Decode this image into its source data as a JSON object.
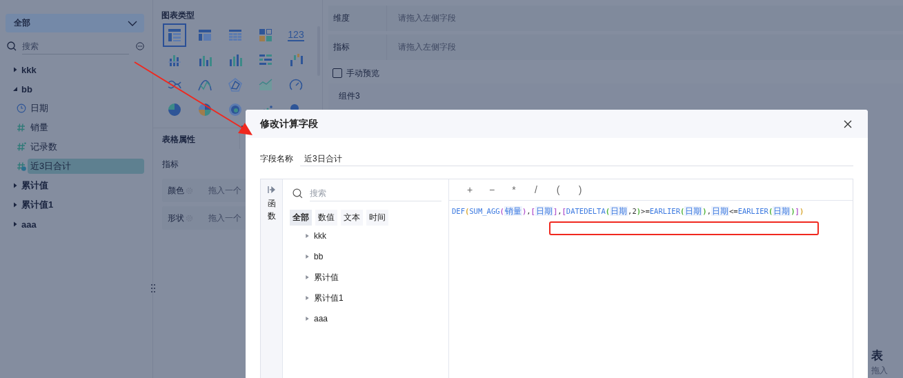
{
  "sidebar": {
    "dropdown": {
      "value": "全部"
    },
    "search": {
      "placeholder": "搜索"
    },
    "tree": [
      {
        "label": "kkk",
        "expanded": false
      },
      {
        "label": "bb",
        "expanded": true,
        "children": [
          {
            "label": "日期",
            "kind": "date",
            "selected": false
          },
          {
            "label": "销量",
            "kind": "measure",
            "selected": false
          },
          {
            "label": "记录数",
            "kind": "count",
            "selected": false
          },
          {
            "label": "近3日合计",
            "kind": "calc",
            "selected": true
          }
        ]
      },
      {
        "label": "累计值",
        "expanded": false
      },
      {
        "label": "累计值1",
        "expanded": false
      },
      {
        "label": "aaa",
        "expanded": false
      }
    ]
  },
  "chart_panel": {
    "title": "图表类型",
    "types": [
      {
        "kind": "table",
        "selected": true
      },
      {
        "kind": "cross-table",
        "selected": false
      },
      {
        "kind": "detail-table",
        "selected": false
      },
      {
        "kind": "color-block",
        "selected": false
      },
      {
        "kind": "kpi",
        "label": "123",
        "selected": false
      },
      {
        "kind": "grouped-bar",
        "selected": false
      },
      {
        "kind": "bar",
        "selected": false
      },
      {
        "kind": "multi-bar",
        "selected": false
      },
      {
        "kind": "horizontal-bar",
        "selected": false
      },
      {
        "kind": "waterfall",
        "selected": false
      },
      {
        "kind": "line",
        "selected": false
      },
      {
        "kind": "cross-line",
        "selected": false
      },
      {
        "kind": "radar",
        "selected": false
      },
      {
        "kind": "area",
        "selected": false
      },
      {
        "kind": "gauge",
        "selected": false
      },
      {
        "kind": "pie",
        "selected": false
      },
      {
        "kind": "multi-pie",
        "selected": false
      },
      {
        "kind": "donut",
        "selected": false
      },
      {
        "kind": "scatter",
        "selected": false
      },
      {
        "kind": "bubble",
        "selected": false
      }
    ]
  },
  "properties": {
    "tab": "表格属性",
    "section": "指标",
    "rows": [
      {
        "label": "颜色",
        "hint": "拖入一个"
      },
      {
        "label": "形状",
        "hint": "拖入一个"
      }
    ]
  },
  "shelf": {
    "rows": [
      {
        "label": "维度",
        "placeholder": "请拖入左侧字段"
      },
      {
        "label": "指标",
        "placeholder": "请拖入左侧字段"
      }
    ],
    "manual_preview": {
      "label": "手动预览",
      "checked": false
    },
    "component": {
      "title": "组件3",
      "heading": "表",
      "hint": "拖入"
    }
  },
  "dialog": {
    "title": "修改计算字段",
    "name_label": "字段名称",
    "name_value": "近3日合计",
    "side_tab": "函数",
    "search": {
      "placeholder": "搜索"
    },
    "tabs": [
      {
        "label": "全部",
        "selected": true
      },
      {
        "label": "数值",
        "selected": false
      },
      {
        "label": "文本",
        "selected": false
      },
      {
        "label": "时间",
        "selected": false
      }
    ],
    "tree": [
      {
        "label": "kkk",
        "expanded": false
      },
      {
        "label": "bb",
        "expanded": false
      },
      {
        "label": "累计值",
        "expanded": false
      },
      {
        "label": "累计值1",
        "expanded": false
      },
      {
        "label": "aaa",
        "expanded": false
      }
    ],
    "operators": [
      "+",
      "−",
      "*",
      "/",
      "(",
      ")"
    ],
    "formula": [
      {
        "kind": "func",
        "text": "DEF"
      },
      {
        "kind": "outer",
        "text": "("
      },
      {
        "kind": "func",
        "text": "SUM_AGG"
      },
      {
        "kind": "middle",
        "text": "("
      },
      {
        "kind": "field",
        "text": "销量"
      },
      {
        "kind": "middle",
        "text": ")"
      },
      {
        "kind": "punct",
        "text": ","
      },
      {
        "kind": "middle",
        "text": "["
      },
      {
        "kind": "field",
        "text": "日期"
      },
      {
        "kind": "middle",
        "text": "]"
      },
      {
        "kind": "punct",
        "text": ","
      },
      {
        "kind": "middle",
        "text": "["
      },
      {
        "kind": "func",
        "text": "DATEDELTA"
      },
      {
        "kind": "inner",
        "text": "("
      },
      {
        "kind": "field",
        "text": "日期"
      },
      {
        "kind": "punct",
        "text": ",2"
      },
      {
        "kind": "inner",
        "text": ")"
      },
      {
        "kind": "punct",
        "text": ">="
      },
      {
        "kind": "func",
        "text": "EARLIER"
      },
      {
        "kind": "inner",
        "text": "("
      },
      {
        "kind": "field",
        "text": "日期"
      },
      {
        "kind": "inner",
        "text": ")"
      },
      {
        "kind": "punct",
        "text": ","
      },
      {
        "kind": "field",
        "text": "日期"
      },
      {
        "kind": "punct",
        "text": "<="
      },
      {
        "kind": "func",
        "text": "EARLIER"
      },
      {
        "kind": "inner",
        "text": "("
      },
      {
        "kind": "field",
        "text": "日期"
      },
      {
        "kind": "inner",
        "text": ")"
      },
      {
        "kind": "middle",
        "text": "]"
      },
      {
        "kind": "outer",
        "text": ")"
      }
    ]
  },
  "annotations": {
    "arrow": true,
    "highlight_box": true
  }
}
